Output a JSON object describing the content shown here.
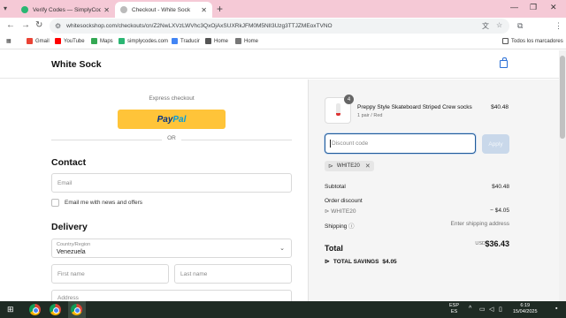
{
  "browser": {
    "tabs": [
      {
        "title": "Verify Codes — SimplyCodes",
        "active": false
      },
      {
        "title": "Checkout - White Sock",
        "active": true
      }
    ],
    "url": "whitesockshop.com/checkouts/cn/Z2NwLXVzLWVhc3QxOjAxSUXRkJFM0M5NlI3Uzg3TTJZMEoxTVNO",
    "bookmarks": [
      "Gmail",
      "YouTube",
      "Maps",
      "simplycodes.com",
      "Traducir",
      "Home",
      "Home"
    ],
    "all_bookmarks": "Todos los marcadores"
  },
  "store": {
    "name": "White Sock"
  },
  "checkout": {
    "express_label": "Express checkout",
    "paypal_pay": "Pay",
    "paypal_pal": "Pal",
    "or_label": "OR",
    "contact_title": "Contact",
    "email_placeholder": "Email",
    "email_news_label": "Email me with news and offers",
    "delivery_title": "Delivery",
    "country_label": "Country/Region",
    "country_value": "Venezuela",
    "first_name_placeholder": "First name",
    "last_name_placeholder": "Last name",
    "address_placeholder": "Address"
  },
  "summary": {
    "product": {
      "name": "Preppy Style Skateboard Striped Crew socks",
      "variant": "1 pair / Red",
      "price": "$40.48",
      "quantity": "4"
    },
    "discount_placeholder": "Discount code",
    "apply_label": "Apply",
    "applied_code": "WHITE20",
    "subtotal_label": "Subtotal",
    "subtotal_value": "$40.48",
    "order_discount_label": "Order discount",
    "discount_code": "WHITE20",
    "discount_value": "− $4.05",
    "shipping_label": "Shipping",
    "shipping_value": "Enter shipping address",
    "total_label": "Total",
    "currency": "USD",
    "total_value": "$36.43",
    "savings_label": "TOTAL SAVINGS",
    "savings_value": "$4.05"
  },
  "taskbar": {
    "lang_top": "ESP",
    "lang_bottom": "ES",
    "time": "6:19",
    "date": "15/04/2025"
  },
  "colors": {
    "paypal": "#ffc439",
    "focus": "#1f5a99",
    "tabstrip": "#f5c9d6"
  }
}
